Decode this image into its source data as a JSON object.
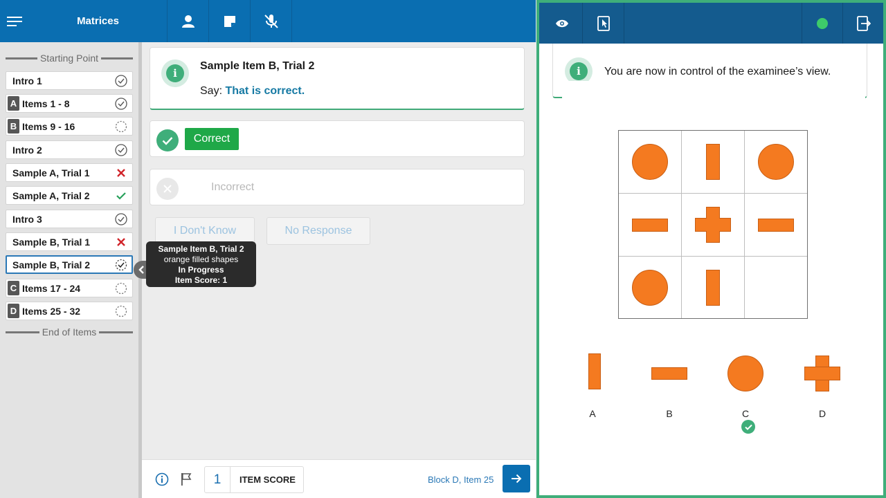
{
  "header": {
    "title": "Matrices",
    "icons": [
      "menu-icon",
      "person-icon",
      "note-icon",
      "microphone-off-icon"
    ]
  },
  "sidebar": {
    "start_label": "Starting Point",
    "end_label": "End of Items",
    "items": [
      {
        "badge": "",
        "label": "Intro 1",
        "status": "complete"
      },
      {
        "badge": "A",
        "label": "Items 1 - 8",
        "status": "complete"
      },
      {
        "badge": "B",
        "label": "Items 9 - 16",
        "status": "not-started"
      },
      {
        "badge": "",
        "label": "Intro 2",
        "status": "complete"
      },
      {
        "badge": "",
        "label": "Sample A, Trial 1",
        "status": "incorrect"
      },
      {
        "badge": "",
        "label": "Sample A, Trial 2",
        "status": "correct"
      },
      {
        "badge": "",
        "label": "Intro 3",
        "status": "complete"
      },
      {
        "badge": "",
        "label": "Sample B, Trial 1",
        "status": "incorrect"
      },
      {
        "badge": "",
        "label": "Sample B, Trial 2",
        "status": "in-progress"
      },
      {
        "badge": "C",
        "label": "Items 17 - 24",
        "status": "not-started"
      },
      {
        "badge": "D",
        "label": "Items 25 - 32",
        "status": "not-started"
      }
    ]
  },
  "tooltip": {
    "title": "Sample Item B, Trial 2",
    "subtitle": "orange filled shapes",
    "status": "In Progress",
    "score": "Item Score: 1"
  },
  "item": {
    "title": "Sample Item B, Trial 2",
    "say_prefix": "Say:",
    "say_text": "That is correct."
  },
  "responses": {
    "correct_label": "Correct",
    "incorrect_label": "Incorrect",
    "dont_know_label": "I Don't Know",
    "no_response_label": "No Response"
  },
  "footer": {
    "score_value": "1",
    "score_label": "ITEM SCORE",
    "location": "Block D, Item 25"
  },
  "examinee": {
    "notice": "You are now in control of the examinee’s view.",
    "options": [
      "A",
      "B",
      "C",
      "D"
    ],
    "selected_option": "C",
    "shape_color": "#f47a20",
    "status_color": "#3ecb6a"
  },
  "colors": {
    "header": "#0a6eb1",
    "examinee_header": "#145b8e",
    "accent_green": "#3fae7a",
    "correct_button": "#1fa848"
  }
}
